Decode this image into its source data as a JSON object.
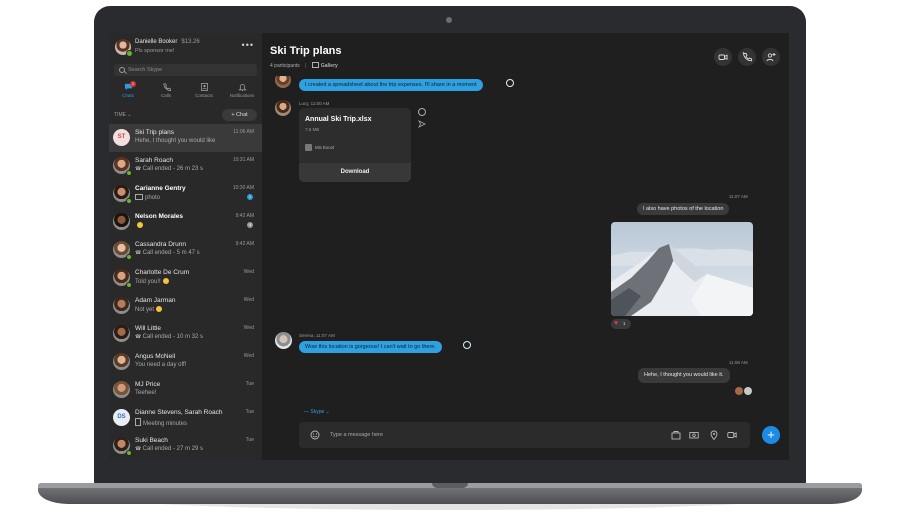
{
  "profile": {
    "name": "Danielle Booker",
    "credit": "$13.26",
    "status": "Pls sponsor me!"
  },
  "search": {
    "placeholder": "Search Skype"
  },
  "nav": [
    {
      "label": "Chats",
      "badge": "1"
    },
    {
      "label": "Calls"
    },
    {
      "label": "Contacts"
    },
    {
      "label": "Notifications"
    }
  ],
  "list_header": {
    "sort_label": "TIME ⌄",
    "new_chat": "+ Chat"
  },
  "chats": [
    {
      "name": "Ski Trip plans",
      "preview": "Hehe, I thought you would like",
      "time": "11:06 AM",
      "initials": "ST",
      "bold": false,
      "selected": true
    },
    {
      "name": "Sarah Roach",
      "preview": "Call ended - 26 m 23 s",
      "time": "10:31 AM",
      "call": true
    },
    {
      "name": "Carianne Gentry",
      "preview": "photo",
      "time": "10:30 AM",
      "bold": true,
      "badge": "1",
      "photo": true
    },
    {
      "name": "Nelson Morales",
      "preview": "",
      "time": "9:42 AM",
      "bold": true,
      "badge": "4",
      "emoji": true
    },
    {
      "name": "Cassandra Drunn",
      "preview": "Call ended - 5 m 47 s",
      "time": "9:42 AM",
      "call": true
    },
    {
      "name": "Charlotte De Crum",
      "preview": "Told you!!",
      "time": "Wed",
      "emoji": true
    },
    {
      "name": "Adam Jarman",
      "preview": "Not yet",
      "time": "Wed",
      "emoji": true
    },
    {
      "name": "Will Little",
      "preview": "Call ended - 10 m 32 s",
      "time": "Wed",
      "call": true
    },
    {
      "name": "Angus McNeil",
      "preview": "You need a day off!",
      "time": "Wed"
    },
    {
      "name": "MJ Price",
      "preview": "Teehee!",
      "time": "Tue"
    },
    {
      "name": "Dianne Stevens, Sarah Roach",
      "preview": "Meeting minutes",
      "time": "Tue",
      "initials": "DS",
      "file": true
    },
    {
      "name": "Suki Beach",
      "preview": "Call ended - 27 m 29 s",
      "time": "Tue",
      "call": true
    }
  ],
  "conversation": {
    "title": "Ski Trip plans",
    "participants": "4 participants",
    "separator": "|",
    "gallery": "Gallery"
  },
  "messages": {
    "m1_text": "I created a spreadsheet about the trip expenses. I'll share in a moment",
    "m2_meta": "Lucy, 11:00 AM",
    "file": {
      "name": "Annual Ski Trip.xlsx",
      "size": "7,6 MB",
      "app": "MS Excel",
      "action": "Download"
    },
    "m3_time": "11:07 AM",
    "m3_text": "I also have photos of the location",
    "reaction_count": "1",
    "m4_meta": "Serena, 11:07 AM",
    "m4_text": "Wow this location is gorgeous! I can't wait to go there.",
    "m5_time": "11:08 AM",
    "m5_text": "Hehe, I thought you would like it."
  },
  "composer": {
    "tag": "— Skype ⌄",
    "placeholder": "Type a message here"
  },
  "colors": {
    "accent": "#2f9bdc",
    "in_bubble": "#2fa0e0",
    "out_bubble": "#3a3a3a",
    "send": "#1b8ce6"
  }
}
